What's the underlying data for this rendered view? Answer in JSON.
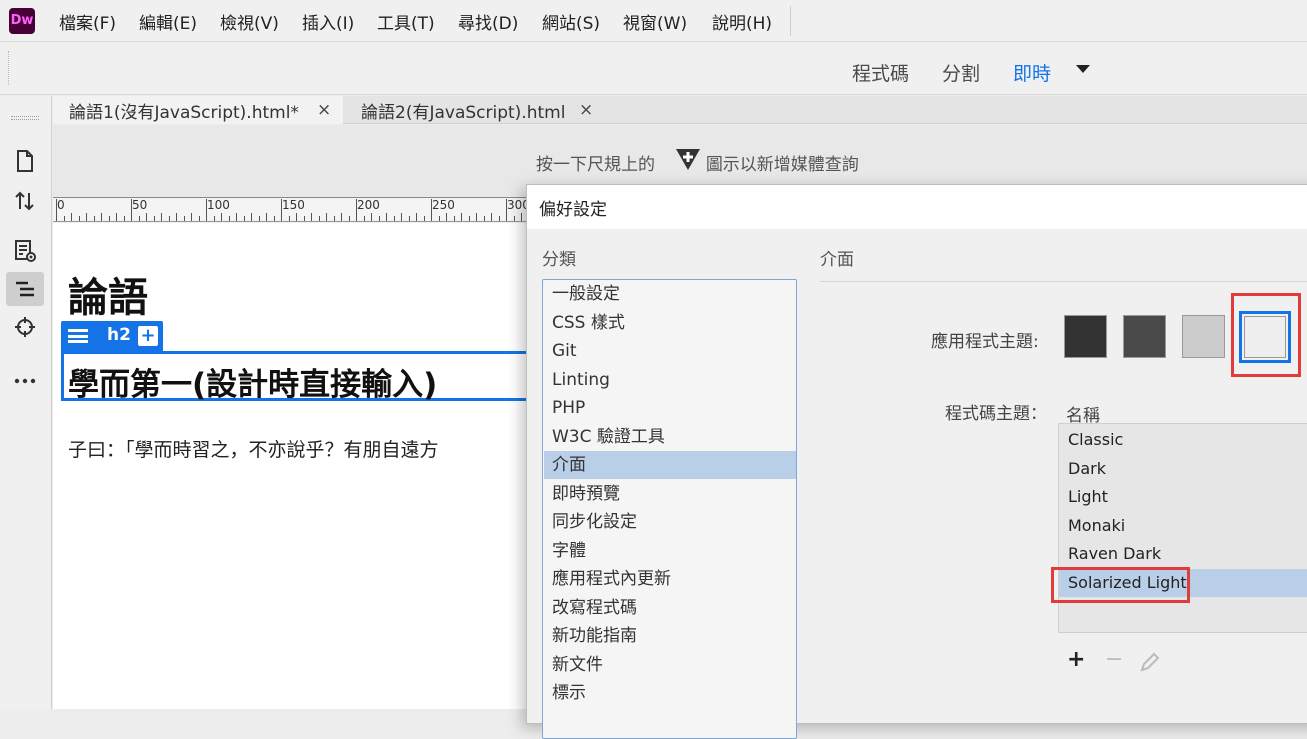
{
  "app": {
    "logo": "Dw"
  },
  "menu": [
    "檔案(F)",
    "編輯(E)",
    "檢視(V)",
    "插入(I)",
    "工具(T)",
    "尋找(D)",
    "網站(S)",
    "視窗(W)",
    "說明(H)"
  ],
  "view_modes": {
    "code": "程式碼",
    "split": "分割",
    "live": "即時",
    "active": "即時"
  },
  "left_tools": [
    "file-icon",
    "transfer-icon",
    "inspect-icon",
    "dom-icon",
    "target-icon",
    "more-icon"
  ],
  "doc_tabs": [
    {
      "label": "論語1(沒有JavaScript).html*",
      "close": "×",
      "active": true
    },
    {
      "label": "論語2(有JavaScript).html",
      "close": "×",
      "active": false
    }
  ],
  "media_query_hint": {
    "before": "按一下尺規上的",
    "after": "圖示以新增媒體查詢"
  },
  "ruler": [
    "0",
    "50",
    "100",
    "150",
    "200",
    "250",
    "300"
  ],
  "document": {
    "h1": "論語",
    "element_tag": "h2",
    "element_add": "+",
    "h2": "學而第一(設計時直接輸入)",
    "paragraph": "子曰：「學而時習之，不亦說乎？有朋自遠方"
  },
  "dialog": {
    "title": "偏好設定",
    "category_label": "分類",
    "categories": [
      "一般設定",
      "CSS 樣式",
      "Git",
      "Linting",
      "PHP",
      "W3C 驗證工具",
      "介面",
      "即時預覽",
      "同步化設定",
      "字體",
      "應用程式內更新",
      "改寫程式碼",
      "新功能指南",
      "新文件",
      "標示"
    ],
    "selected_category": "介面",
    "section_title": "介面",
    "app_theme_label": "應用程式主題:",
    "app_themes": [
      "#333333",
      "#4a4a4a",
      "#cccccc",
      "#eeeeee"
    ],
    "selected_app_theme": 3,
    "code_theme_label": "程式碼主題：",
    "code_theme_column": "名稱",
    "code_themes": [
      "Classic",
      "Dark",
      "Light",
      "Monaki",
      "Raven Dark",
      "Solarized Light"
    ],
    "selected_code_theme": "Solarized Light",
    "controls": {
      "add": "+",
      "remove": "−"
    },
    "highlight_color": "#e03c3c",
    "accent_color": "#1473e6"
  }
}
